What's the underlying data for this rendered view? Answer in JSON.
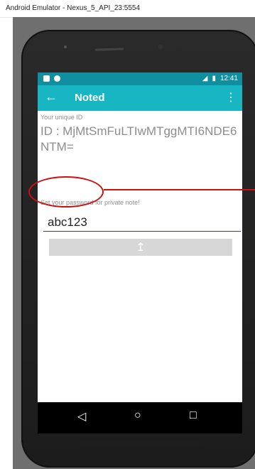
{
  "window": {
    "title": "Android Emulator - Nexus_5_API_23:5554"
  },
  "statusbar": {
    "time": "12:41",
    "signal_icon": "signal-icon",
    "battery_icon": "battery-icon"
  },
  "appbar": {
    "title": "Noted",
    "back_icon": "back-arrow-icon",
    "menu_icon": "overflow-menu-icon"
  },
  "content": {
    "id_label": "Your unique ID",
    "id_value": "ID : MjMtSmFuLTIwMTggMTI6NDE6NTM=",
    "password_label": "Set your password for private note!",
    "password_value": "abc123",
    "upload_icon": "upload-icon"
  },
  "navbar": {
    "back": "back-nav-icon",
    "home": "home-nav-icon",
    "recents": "recents-nav-icon"
  },
  "colors": {
    "status": "#0f8fa0",
    "appbar": "#18b6c3",
    "annotation": "#cc1111"
  }
}
